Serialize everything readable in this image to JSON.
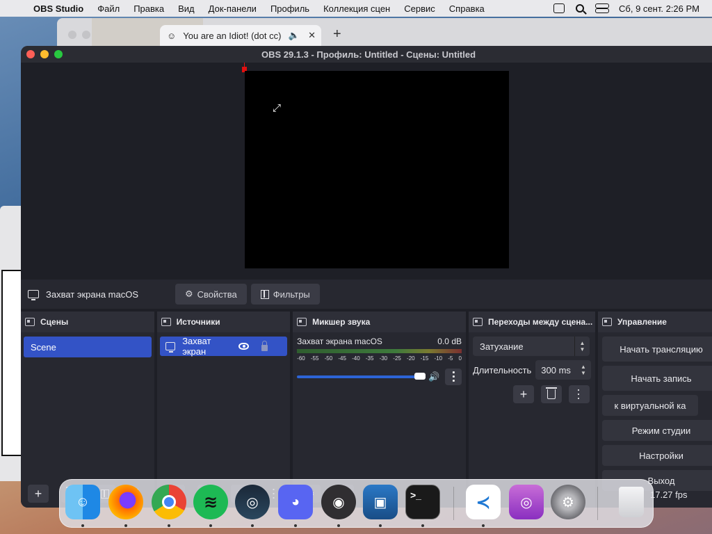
{
  "menubar": {
    "app_name": "OBS Studio",
    "items": [
      "Файл",
      "Правка",
      "Вид",
      "Док-панели",
      "Профиль",
      "Коллекция сцен",
      "Сервис",
      "Справка"
    ],
    "datetime": "Сб, 9 сент.  2:26 PM"
  },
  "browser": {
    "tab_title": "You are an Idiot! (dot cc)",
    "tab_emoji": "☺",
    "audio_icon": "🔈",
    "close": "✕",
    "new_tab": "+"
  },
  "obs": {
    "title": "OBS 29.1.3 - Профиль: Untitled - Сцены: Untitled",
    "context_source": "Захват экрана macOS",
    "properties_label": "Свойства",
    "filters_label": "Фильтры",
    "scenes": {
      "title": "Сцены",
      "items": [
        "Scene"
      ]
    },
    "sources": {
      "title": "Источники",
      "items": [
        "Захват экран"
      ]
    },
    "mixer": {
      "title": "Микшер звука",
      "channel": "Захват экрана macOS",
      "level": "0.0 dB",
      "ticks": [
        "-60",
        "-55",
        "-50",
        "-45",
        "-40",
        "-35",
        "-30",
        "-25",
        "-20",
        "-15",
        "-10",
        "-5",
        "0"
      ],
      "volume": 1.0
    },
    "transitions": {
      "title": "Переходы между сцена...",
      "selected": "Затухание",
      "duration_label": "Длительность",
      "duration_value": "300 ms"
    },
    "controls": {
      "title": "Управление",
      "start_stream": "Начать трансляцию",
      "start_record": "Начать запись",
      "virtual_cam": "к виртуальной ка",
      "studio_mode": "Режим студии",
      "settings": "Настройки",
      "exit": "Выход"
    },
    "fps": "17.27 fps"
  },
  "dock_apps": [
    "finder-icon",
    "firefox-icon",
    "chrome-icon",
    "spotify-icon",
    "steam-icon",
    "discord-icon",
    "obs-icon",
    "virtualbox-icon",
    "terminal-icon",
    "vscode-icon",
    "podcasts-icon",
    "system-settings-icon",
    "trash-icon"
  ]
}
